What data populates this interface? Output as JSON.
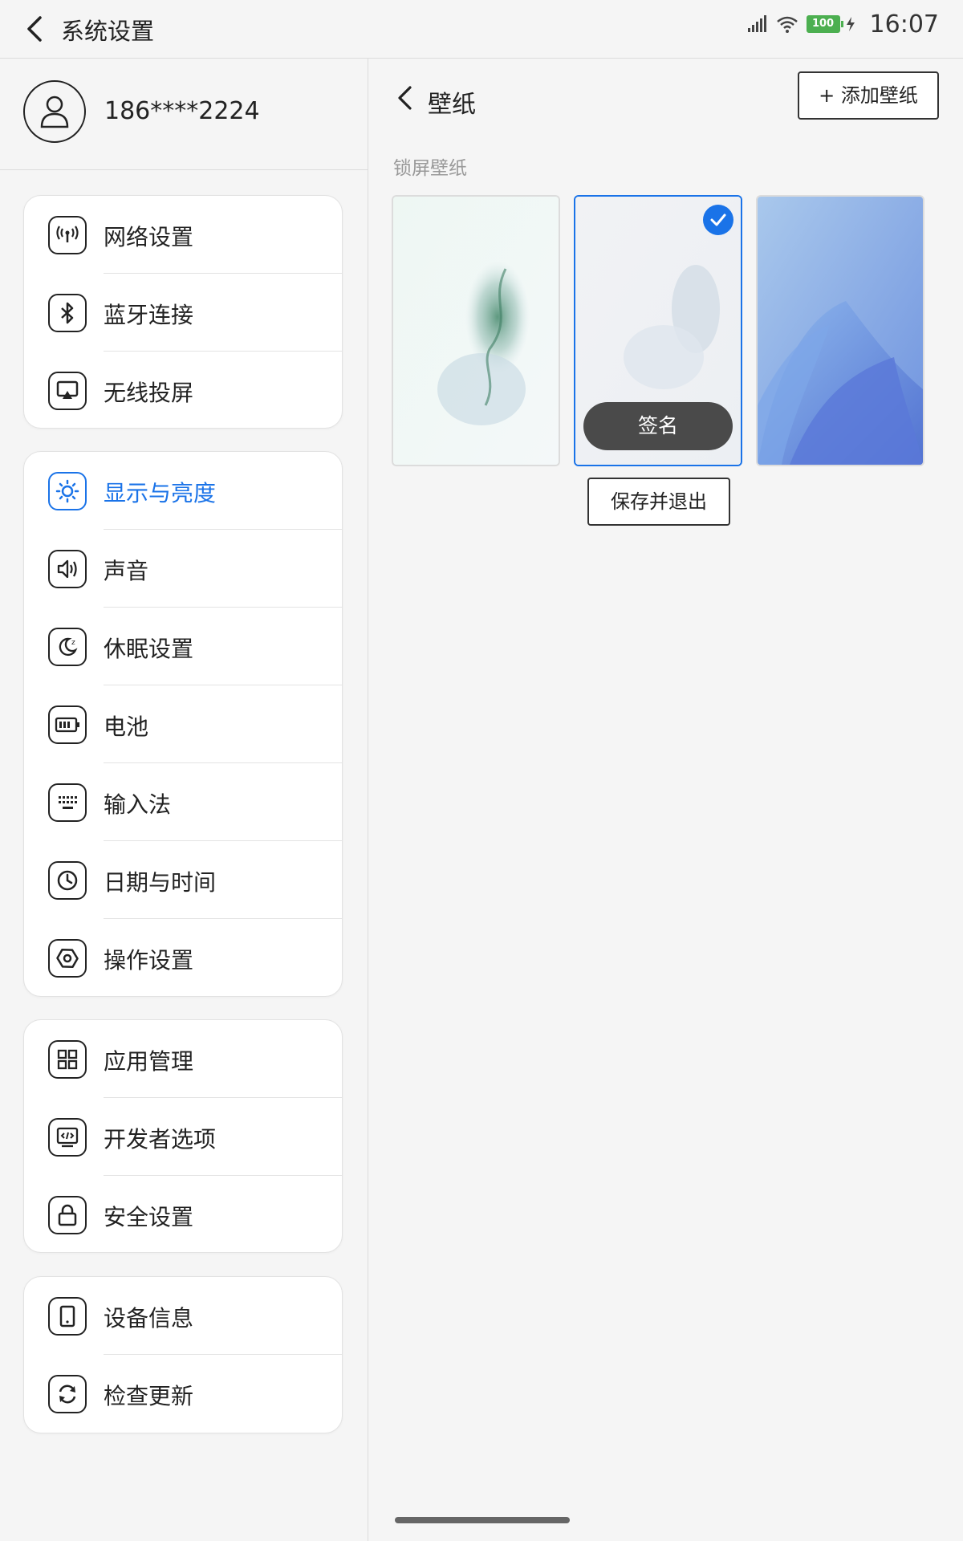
{
  "topbar": {
    "title": "系统设置"
  },
  "status": {
    "battery": "100",
    "time": "16:07"
  },
  "account": {
    "phone": "186****2224"
  },
  "menu": {
    "group1": [
      {
        "label": "网络设置",
        "icon": "antenna-icon"
      },
      {
        "label": "蓝牙连接",
        "icon": "bluetooth-icon"
      },
      {
        "label": "无线投屏",
        "icon": "cast-icon"
      }
    ],
    "group2": [
      {
        "label": "显示与亮度",
        "icon": "brightness-icon",
        "active": true
      },
      {
        "label": "声音",
        "icon": "speaker-icon"
      },
      {
        "label": "休眠设置",
        "icon": "sleep-icon"
      },
      {
        "label": "电池",
        "icon": "battery-icon"
      },
      {
        "label": "输入法",
        "icon": "keyboard-icon"
      },
      {
        "label": "日期与时间",
        "icon": "clock-icon"
      },
      {
        "label": "操作设置",
        "icon": "hexagon-icon"
      }
    ],
    "group3": [
      {
        "label": "应用管理",
        "icon": "apps-grid-icon"
      },
      {
        "label": "开发者选项",
        "icon": "code-icon"
      },
      {
        "label": "安全设置",
        "icon": "lock-icon"
      }
    ],
    "group4": [
      {
        "label": "设备信息",
        "icon": "tablet-icon"
      },
      {
        "label": "检查更新",
        "icon": "refresh-icon"
      }
    ]
  },
  "wallpaper": {
    "title": "壁纸",
    "add_button": "+ 添加壁纸",
    "section_label": "锁屏壁纸",
    "sign_button": "签名",
    "save_button": "保存并退出",
    "selected_index": 1
  },
  "colors": {
    "accent": "#1a73e8",
    "text": "#222222",
    "muted": "#999999"
  }
}
